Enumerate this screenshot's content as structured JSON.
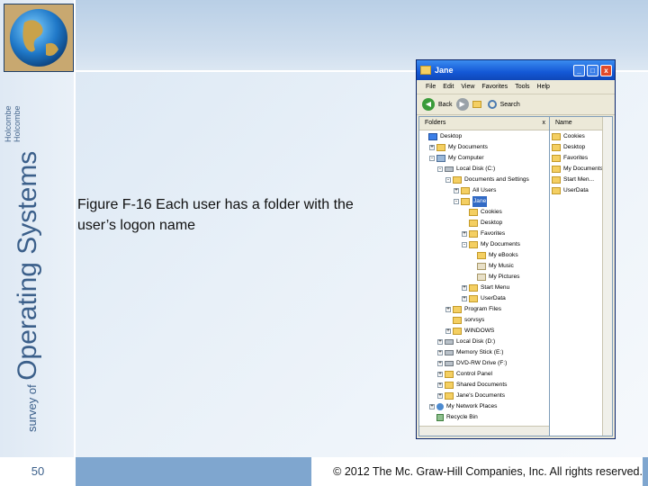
{
  "slide": {
    "series_prefix": "survey of",
    "series_title": "Operating Systems",
    "authors": [
      "Holcombe",
      "Holcombe"
    ],
    "caption": "Figure F-16 Each user has a folder with the user’s logon name",
    "page_number": "50",
    "copyright": "© 2012 The Mc. Graw-Hill Companies, Inc. All rights reserved."
  },
  "explorer": {
    "title": "Jane",
    "window_buttons": [
      "_",
      "□",
      "x"
    ],
    "menu": [
      "File",
      "Edit",
      "View",
      "Favorites",
      "Tools",
      "Help"
    ],
    "toolbar": {
      "back": "Back",
      "search": "Search"
    },
    "folders_header": "Folders",
    "close_glyph": "x",
    "name_header": "Name",
    "tree": [
      {
        "label": "Desktop",
        "indent": 0,
        "icon": "desk",
        "expander": ""
      },
      {
        "label": "My Documents",
        "indent": 1,
        "icon": "folder",
        "expander": "+"
      },
      {
        "label": "My Computer",
        "indent": 1,
        "icon": "comp",
        "expander": "-"
      },
      {
        "label": "Local Disk (C:)",
        "indent": 2,
        "icon": "drive",
        "expander": "-"
      },
      {
        "label": "Documents and Settings",
        "indent": 3,
        "icon": "folder",
        "expander": "-"
      },
      {
        "label": "All Users",
        "indent": 4,
        "icon": "folder",
        "expander": "+"
      },
      {
        "label": "Jane",
        "indent": 4,
        "icon": "folder",
        "expander": "-",
        "selected": true
      },
      {
        "label": "Cookies",
        "indent": 5,
        "icon": "folder",
        "expander": ""
      },
      {
        "label": "Desktop",
        "indent": 5,
        "icon": "folder",
        "expander": ""
      },
      {
        "label": "Favorites",
        "indent": 5,
        "icon": "folder",
        "expander": "+"
      },
      {
        "label": "My Documents",
        "indent": 5,
        "icon": "folder",
        "expander": "-"
      },
      {
        "label": "My eBooks",
        "indent": 6,
        "icon": "folder",
        "expander": ""
      },
      {
        "label": "My Music",
        "indent": 6,
        "icon": "media",
        "expander": ""
      },
      {
        "label": "My Pictures",
        "indent": 6,
        "icon": "media",
        "expander": ""
      },
      {
        "label": "Start Menu",
        "indent": 5,
        "icon": "folder",
        "expander": "+"
      },
      {
        "label": "UserData",
        "indent": 5,
        "icon": "folder",
        "expander": "+"
      },
      {
        "label": "Program Files",
        "indent": 3,
        "icon": "folder",
        "expander": "+"
      },
      {
        "label": "sorvsys",
        "indent": 3,
        "icon": "folder",
        "expander": ""
      },
      {
        "label": "WINDOWS",
        "indent": 3,
        "icon": "folder",
        "expander": "+"
      },
      {
        "label": "Local Disk (D:)",
        "indent": 2,
        "icon": "drive",
        "expander": "+"
      },
      {
        "label": "Memory Stick (E:)",
        "indent": 2,
        "icon": "drive",
        "expander": "+"
      },
      {
        "label": "DVD-RW Drive (F:)",
        "indent": 2,
        "icon": "drive",
        "expander": "+"
      },
      {
        "label": "Control Panel",
        "indent": 2,
        "icon": "folder",
        "expander": "+"
      },
      {
        "label": "Shared Documents",
        "indent": 2,
        "icon": "folder",
        "expander": "+"
      },
      {
        "label": "Jane's Documents",
        "indent": 2,
        "icon": "folder",
        "expander": "+"
      },
      {
        "label": "My Network Places",
        "indent": 1,
        "icon": "net",
        "expander": "+"
      },
      {
        "label": "Recycle Bin",
        "indent": 1,
        "icon": "bin",
        "expander": ""
      }
    ],
    "names": [
      "Cookies",
      "Desktop",
      "Favorites",
      "My Documents",
      "Start Men...",
      "UserData"
    ]
  }
}
